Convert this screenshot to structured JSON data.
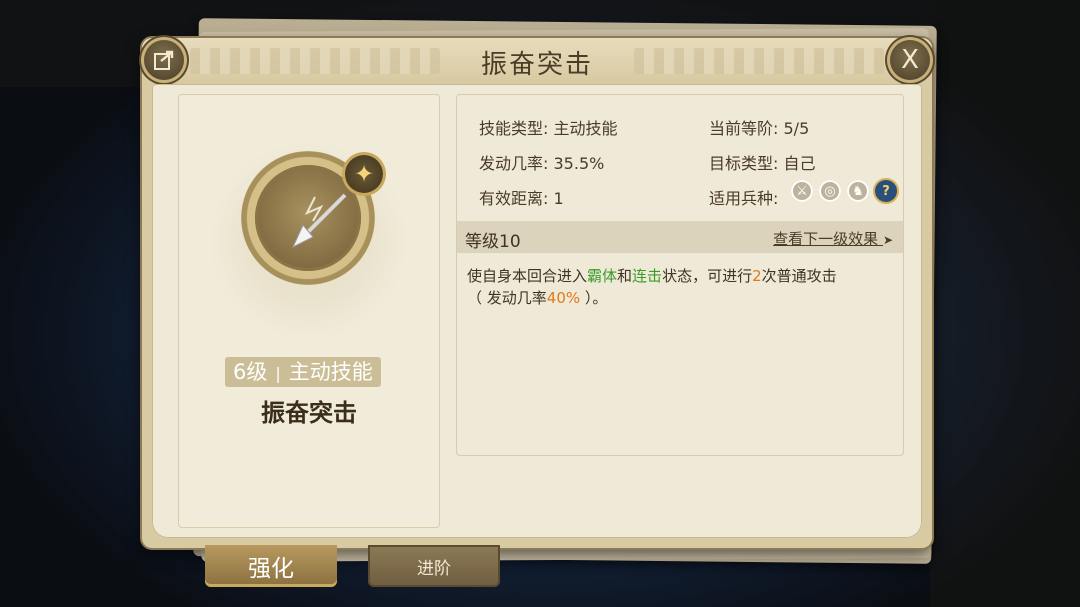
{
  "dialog": {
    "title": "振奋突击",
    "close_glyph": "X"
  },
  "skill": {
    "level_label": "6级",
    "type_label": "主动技能",
    "name": "振奋突击"
  },
  "stats": {
    "skill_type_label": "技能类型:",
    "skill_type_value": "主动技能",
    "current_rank_label": "当前等阶:",
    "current_rank_value": "5/5",
    "trigger_rate_label": "发动几率:",
    "trigger_rate_value": "35.5%",
    "target_type_label": "目标类型:",
    "target_type_value": "自己",
    "range_label": "有效距离:",
    "range_value": "1",
    "applicable_units_label": "适用兵种:",
    "unit_icons": [
      "sword-icon",
      "target-icon",
      "horse-icon",
      "help-icon"
    ]
  },
  "level_section": {
    "level": "等级10",
    "next_level_link": "查看下一级效果",
    "arrow": "➤"
  },
  "description": {
    "part1": "使自身本回合进入",
    "highlight1": "霸体",
    "part2": "和",
    "highlight2": "连击",
    "part3": "状态，可进行",
    "count": "2",
    "part4": "次普通攻击",
    "part5": "（ 发动几率",
    "rate": "40%",
    "part6": " ）。"
  },
  "tabs": {
    "strengthen": "强化",
    "advance": "进阶"
  },
  "colors": {
    "highlight_green": "#3c9b2c",
    "highlight_orange": "#e07a1a",
    "panel_bg": "#efe9d7"
  }
}
